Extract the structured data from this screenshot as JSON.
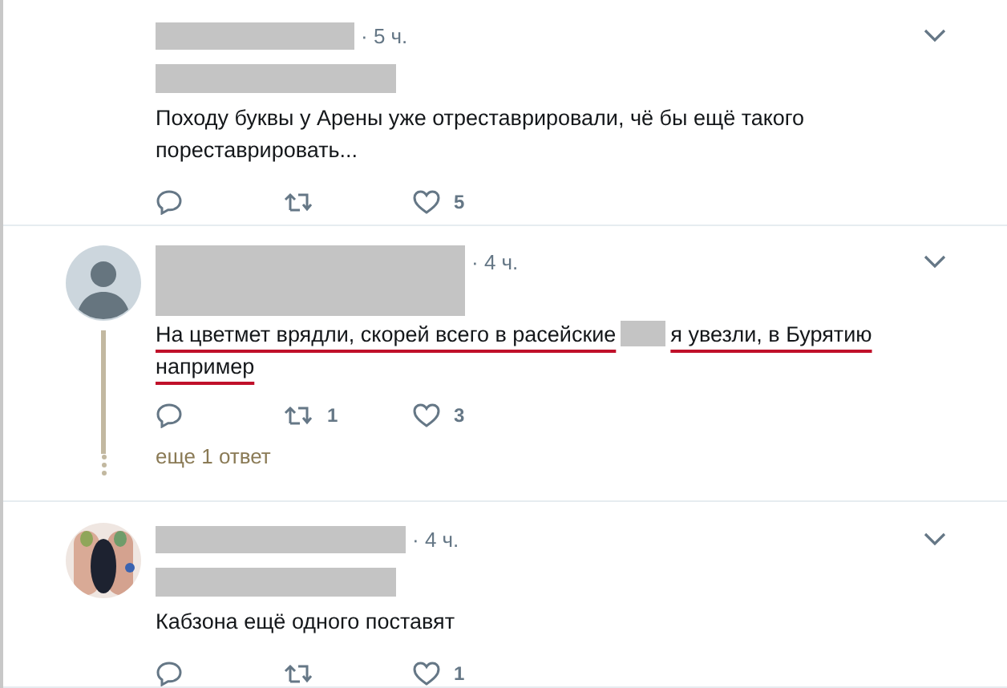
{
  "tweets": [
    {
      "time": "· 5 ч.",
      "text_parts": [
        "Походу буквы у Арены уже отреставрировали, чё бы ещё такого пореставрировать..."
      ],
      "underlined": false,
      "actions": {
        "likes": "5"
      },
      "second_line_redacted": true
    },
    {
      "avatar": {
        "kind": "placeholder"
      },
      "time": "· 4 ч.",
      "text_parts": [
        "На цветмет врядли, скорей всего в расейские",
        "я увезли, в Бурятию например"
      ],
      "underlined": true,
      "actions": {
        "retweets": "1",
        "likes": "3"
      },
      "thread_link": "еще 1 ответ",
      "second_line_redacted": false
    },
    {
      "avatar": {
        "kind": "picture"
      },
      "time": "· 4 ч.",
      "text_parts": [
        "Кабзона ещё одного поставят"
      ],
      "underlined": false,
      "actions": {
        "likes": "1"
      },
      "second_line_redacted": true
    }
  ]
}
